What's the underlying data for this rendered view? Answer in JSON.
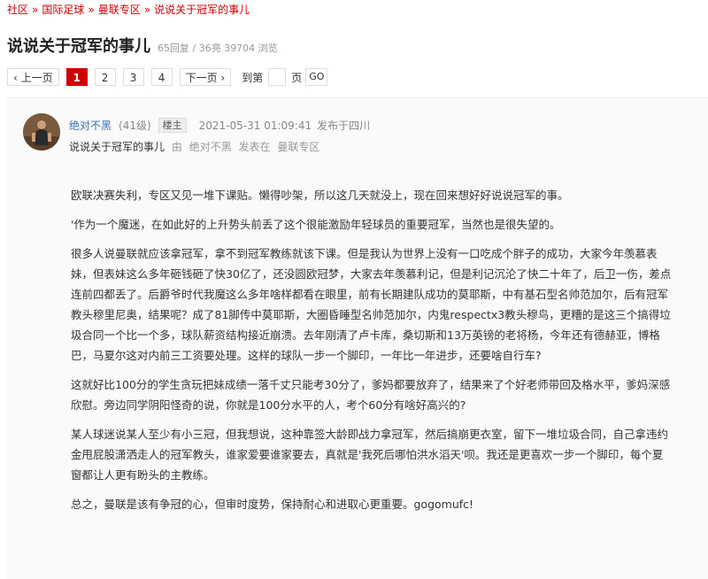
{
  "breadcrumb": [
    "社区",
    "国际足球",
    "曼联专区",
    "说说关于冠军的事儿"
  ],
  "breadcrumb_sep": "»",
  "thread": {
    "title": "说说关于冠军的事儿",
    "stats": "65回复 / 36亮 39704 浏览"
  },
  "pager": {
    "prev": "‹ 上一页",
    "pages": [
      "1",
      "2",
      "3",
      "4"
    ],
    "active": "1",
    "next": "下一页 ›",
    "goto_label": "到第",
    "page_unit": "页",
    "go": "GO"
  },
  "post": {
    "username": "绝对不黑",
    "level": "(41级)",
    "floor_tag": "楼主",
    "datetime": "2021-05-31 01:09:41",
    "location": "发布于四川",
    "subject": "说说关于冠军的事儿",
    "by": "由",
    "author": "绝对不黑",
    "posted_in": "发表在",
    "forum": "曼联专区",
    "paragraphs": [
      "欧联决赛失利，专区又见一堆下课贴。懒得吵架，所以这几天就没上，现在回来想好好说说冠军的事。",
      "'作为一个魔迷，在如此好的上升势头前丢了这个很能激励年轻球员的重要冠军，当然也是很失望的。",
      "很多人说曼联就应该拿冠军，拿不到冠军教练就该下课。但是我认为世界上没有一口吃成个胖子的成功，大家今年羡慕表妹，但表妹这么多年砸钱砸了快30亿了，还没圆欧冠梦，大家去年羡慕利记，但是利记沉沦了快二十年了，后卫一伤，差点连前四都丢了。后爵爷时代我魔这么多年啥样都看在眼里，前有长期建队成功的莫耶斯，中有基石型名帅范加尔，后有冠军教头穆里尼奥，结果呢？成了81脚传中莫耶斯，大圈昏睡型名帅范加尔，内鬼respectx3教头穆鸟，更糟的是这三个搞得垃圾合同一个比一个多，球队薪资结构接近崩溃。去年刚清了卢卡库，桑切斯和13万英镑的老将杨，今年还有德赫亚，博格巴，马夏尔这对内前三工资要处理。这样的球队一步一个脚印，一年比一年进步，还要啥自行车?",
      "这就好比100分的学生贪玩把妹成绩一落千丈只能考30分了，爹妈都要放弃了，结果来了个好老师带回及格水平，爹妈深感欣慰。旁边同学阴阳怪奇的说，你就是100分水平的人，考个60分有啥好高兴的?",
      "某人球迷说某人至少有小三冠，但我想说，这种靠签大龄即战力拿冠军，然后搞崩更衣室，留下一堆垃圾合同，自己拿违约金甩屁股潇洒走人的冠军教头，谁家爱要谁家要去，真就是'我死后哪怕洪水滔天'呗。我还是更喜欢一步一个脚印，每个夏窗都让人更有盼头的主教练。",
      "总之，曼联是该有争冠的心，但审时度势，保持耐心和进取心更重要。gogomufc!"
    ]
  }
}
